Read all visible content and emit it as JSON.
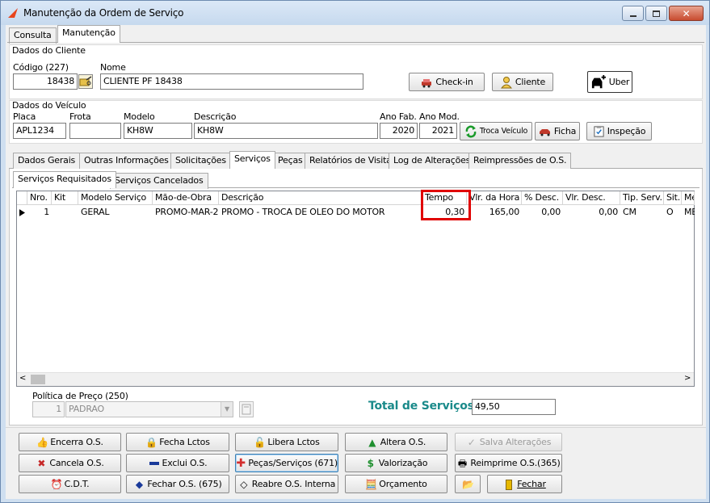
{
  "window": {
    "title": "Manutenção da Ordem de Serviço",
    "accent": "#cfdff0",
    "highlight_color": "#e00000"
  },
  "top_tabs": [
    "Consulta",
    "Manutenção"
  ],
  "cliente": {
    "group_title": "Dados do Cliente",
    "codigo_label": "Código (227)",
    "codigo_value": "18438",
    "nome_label": "Nome",
    "nome_value": "CLIENTE PF 18438",
    "checkin_label": "Check-in",
    "cliente_label": "Cliente",
    "uber_label": "Uber"
  },
  "veiculo": {
    "group_title": "Dados do Veículo",
    "placa_label": "Placa",
    "placa_value": "APL1234",
    "frota_label": "Frota",
    "frota_value": "",
    "modelo_label": "Modelo",
    "modelo_value": "KH8W",
    "descricao_label": "Descrição",
    "descricao_value": "KH8W",
    "anofab_label": "Ano Fab.",
    "anofab_value": "2020",
    "anomod_label": "Ano Mod.",
    "anomod_value": "2021",
    "troca_label": "Troca Veículo",
    "ficha_label": "Ficha",
    "inspecao_label": "Inspeção"
  },
  "section_tabs": [
    "Dados Gerais",
    "Outras Informações",
    "Solicitações",
    "Serviços",
    "Peças",
    "Relatórios de Visita",
    "Log de Alterações",
    "Reimpressões de O.S."
  ],
  "sub_tabs": [
    "Serviços Requisitados",
    "Serviços Cancelados"
  ],
  "grid": {
    "columns": [
      "Nro.",
      "Kit",
      "Modelo Serviço",
      "Mão-de-Obra",
      "Descrição",
      "Tempo",
      "Vlr. da Hora",
      "% Desc.",
      "Vlr. Desc.",
      "Tip. Serv.",
      "Sit.",
      "Me"
    ],
    "rows": [
      {
        "nro": "1",
        "kit": "",
        "modelo": "GERAL",
        "mao": "PROMO-MAR-2",
        "descricao": "PROMO - TROCA DE OLEO DO MOTOR",
        "tempo": "0,30",
        "vlr_hora": "165,00",
        "pct_desc": "0,00",
        "vlr_desc": "0,00",
        "tip": "CM",
        "sit": "O",
        "me": "ME"
      }
    ]
  },
  "politica": {
    "label": "Política de Preço (250)",
    "code": "1",
    "value": "PADRAO"
  },
  "total": {
    "label": "Total de Serviços",
    "value": "49,50"
  },
  "actions": {
    "encerra": "Encerra O.S.",
    "fecha_lctos": "Fecha Lctos",
    "libera_lctos": "Libera Lctos",
    "altera": "Altera O.S.",
    "salva": "Salva Alterações",
    "cancela": "Cancela O.S.",
    "exclui": "Exclui O.S.",
    "pecas_servicos": "Peças/Serviços (671)",
    "valorizacao": "Valorização",
    "reimprime": "Reimprime O.S.(365)",
    "cdt": "C.D.T.",
    "fechar_os": "Fechar O.S. (675)",
    "reabre": "Reabre O.S. Interna",
    "orcamento": "Orçamento",
    "fechar": "Fechar"
  }
}
